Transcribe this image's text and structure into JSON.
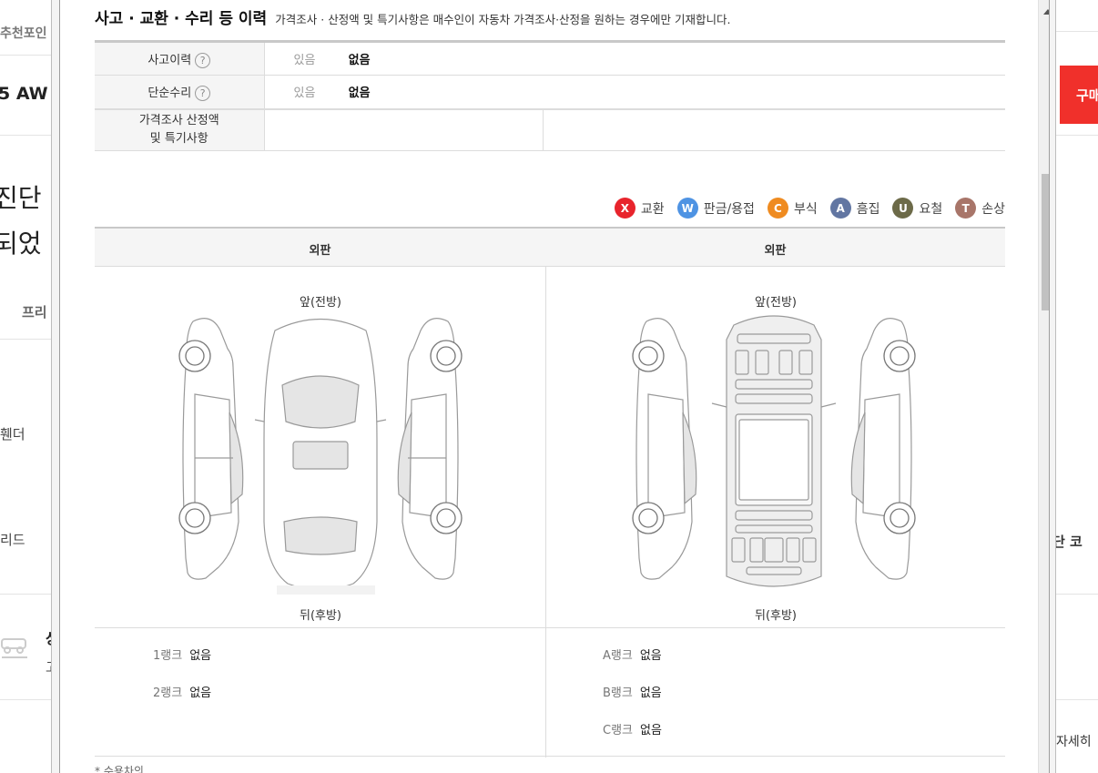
{
  "background": {
    "left_fragments": [
      "추천포인",
      "5 AW",
      "진단",
      "되었",
      "프리",
      "휀더",
      "리드",
      "상",
      "고"
    ],
    "right_fragments": [
      "구매",
      "단 코",
      "자세히"
    ]
  },
  "section": {
    "title": "사고 · 교환 · 수리 등 이력",
    "subtitle": "가격조사 · 산정액 및 특기사항은 매수인이 자동차 가격조사·산정을 원하는 경우에만 기재합니다."
  },
  "history_rows": [
    {
      "label": "사고이력",
      "help_icon": "question-circle-icon",
      "option_muted": "있음",
      "option_selected": "없음"
    },
    {
      "label": "단순수리",
      "help_icon": "question-circle-icon",
      "option_muted": "있음",
      "option_selected": "없음"
    }
  ],
  "price_row": {
    "label_line1": "가격조사 산정액",
    "label_line2": "및 특기사항"
  },
  "legend": [
    {
      "letter": "X",
      "label": "교환",
      "color": "#e8242c"
    },
    {
      "letter": "W",
      "label": "판금/용접",
      "color": "#4e93e3"
    },
    {
      "letter": "C",
      "label": "부식",
      "color": "#ef8b20"
    },
    {
      "letter": "A",
      "label": "흠집",
      "color": "#6276a2"
    },
    {
      "letter": "U",
      "label": "요철",
      "color": "#6c6a48"
    },
    {
      "letter": "T",
      "label": "손상",
      "color": "#a87569"
    }
  ],
  "diagram": {
    "left_header": "외판",
    "right_header": "외판",
    "front_label": "앞(전방)",
    "rear_label": "뒤(후방)"
  },
  "ranks_left": [
    {
      "label": "1랭크",
      "value": "없음"
    },
    {
      "label": "2랭크",
      "value": "없음"
    }
  ],
  "ranks_right": [
    {
      "label": "A랭크",
      "value": "없음"
    },
    {
      "label": "B랭크",
      "value": "없음"
    },
    {
      "label": "C랭크",
      "value": "없음"
    }
  ],
  "footnote": "* 수용차의 ..."
}
